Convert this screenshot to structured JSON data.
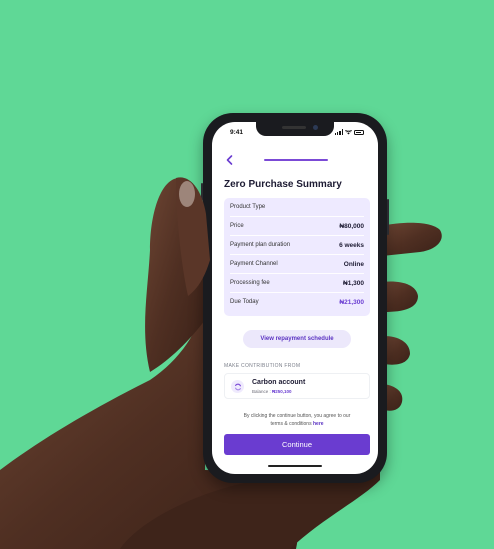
{
  "status_bar": {
    "time": "9:41"
  },
  "header": {
    "title": "Zero Purchase Summary"
  },
  "summary": {
    "rows": [
      {
        "label": "Product Type",
        "value": ""
      },
      {
        "label": "Price",
        "value": "₦80,000"
      },
      {
        "label": "Payment plan duration",
        "value": "6 weeks"
      },
      {
        "label": "Payment Channel",
        "value": "Online"
      },
      {
        "label": "Processing fee",
        "value": "₦1,300"
      },
      {
        "label": "Due Today",
        "value": "₦21,300"
      }
    ]
  },
  "repayment_button": {
    "label": "View repayment schedule"
  },
  "contribution": {
    "section_label": "MAKE CONTRIBUTION FROM",
    "account_name": "Carbon account",
    "balance_prefix": "Balance : ",
    "balance_value": "₦250,100"
  },
  "terms": {
    "text_line1": "By clicking the continue button, you agree to our",
    "text_line2": "terms & conditions ",
    "link": "here"
  },
  "continue_button": {
    "label": "Continue"
  },
  "colors": {
    "background": "#5fd896",
    "accent": "#6a3cd0",
    "card": "#eeeaff"
  },
  "icons": [
    "back-arrow-icon",
    "signal-icon",
    "wifi-icon",
    "battery-icon",
    "refresh-icon"
  ]
}
